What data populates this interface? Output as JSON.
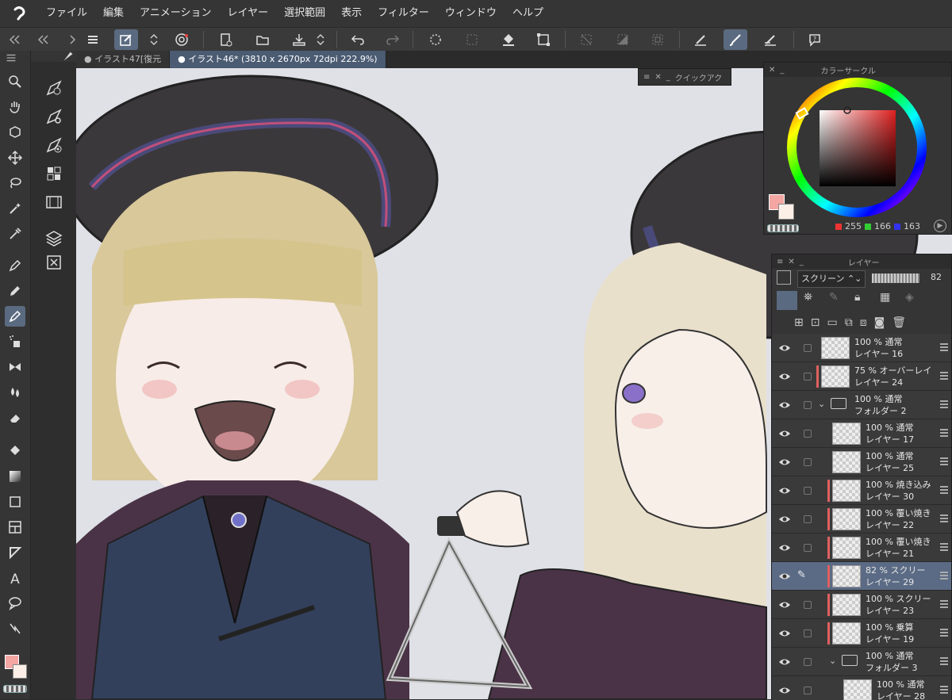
{
  "menubar": {
    "items": [
      "ファイル",
      "編集",
      "アニメーション",
      "レイヤー",
      "選択範囲",
      "表示",
      "フィルター",
      "ウィンドウ",
      "ヘルプ"
    ]
  },
  "tabs": [
    {
      "label": "● イラスト47[復元"
    },
    {
      "label": "● イラスト46* (3810 x 2670px 72dpi 222.9%)"
    }
  ],
  "quick_access": {
    "title": "クイックアク"
  },
  "color_circle": {
    "title": "カラーサークル",
    "r": "255",
    "g": "166",
    "b": "163",
    "main_color": "#f4a6a3",
    "sub_color": "#fcefe8"
  },
  "layers_panel": {
    "title": "レイヤー",
    "blend_mode": "スクリーン",
    "opacity": "82",
    "rows": [
      {
        "line1": "100 % 通常",
        "line2": "レイヤー 16",
        "indent": 0,
        "folder": false,
        "red": false,
        "sel": false,
        "pen": false
      },
      {
        "line1": "75 % オーバーレイ",
        "line2": "レイヤー 24",
        "indent": 0,
        "folder": false,
        "red": true,
        "sel": false,
        "pen": false
      },
      {
        "line1": "100 % 通常",
        "line2": "フォルダー 2",
        "indent": 0,
        "folder": true,
        "red": false,
        "sel": false,
        "pen": false
      },
      {
        "line1": "100 % 通常",
        "line2": "レイヤー 17",
        "indent": 1,
        "folder": false,
        "red": false,
        "sel": false,
        "pen": false
      },
      {
        "line1": "100 % 通常",
        "line2": "レイヤー 25",
        "indent": 1,
        "folder": false,
        "red": false,
        "sel": false,
        "pen": false
      },
      {
        "line1": "100 % 焼き込み",
        "line2": "レイヤー 30",
        "indent": 1,
        "folder": false,
        "red": true,
        "sel": false,
        "pen": false
      },
      {
        "line1": "100 % 覆い焼き",
        "line2": "レイヤー 22",
        "indent": 1,
        "folder": false,
        "red": true,
        "sel": false,
        "pen": false
      },
      {
        "line1": "100 % 覆い焼き",
        "line2": "レイヤー 21",
        "indent": 1,
        "folder": false,
        "red": true,
        "sel": false,
        "pen": false
      },
      {
        "line1": "82 % スクリー",
        "line2": "レイヤー 29",
        "indent": 1,
        "folder": false,
        "red": true,
        "sel": true,
        "pen": true
      },
      {
        "line1": "100 % スクリー",
        "line2": "レイヤー 23",
        "indent": 1,
        "folder": false,
        "red": true,
        "sel": false,
        "pen": false
      },
      {
        "line1": "100 % 乗算",
        "line2": "レイヤー 19",
        "indent": 1,
        "folder": false,
        "red": true,
        "sel": false,
        "pen": false
      },
      {
        "line1": "100 % 通常",
        "line2": "フォルダー 3",
        "indent": 1,
        "folder": true,
        "red": false,
        "sel": false,
        "pen": false
      },
      {
        "line1": "100 % 通常",
        "line2": "レイヤー 28",
        "indent": 2,
        "folder": false,
        "red": false,
        "sel": false,
        "pen": false
      }
    ]
  },
  "toolbox": {
    "main_color": "#f4a6a3",
    "sub_color": "#fcefe8"
  }
}
